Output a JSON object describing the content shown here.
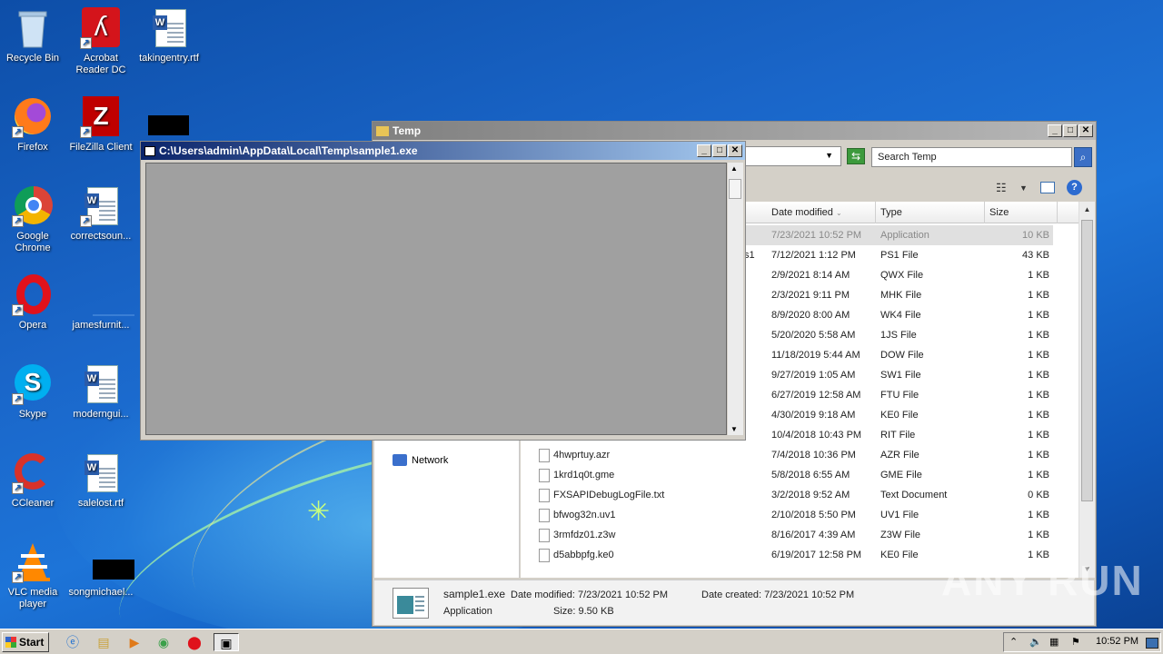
{
  "desktop": {
    "icons": [
      {
        "label": "Recycle Bin"
      },
      {
        "label": "Acrobat Reader DC"
      },
      {
        "label": "takingentry.rtf"
      },
      {
        "label": "Firefox"
      },
      {
        "label": "FileZilla Client"
      },
      {
        "label": "Google Chrome"
      },
      {
        "label": "correctsoun..."
      },
      {
        "label": "Opera"
      },
      {
        "label": "jamesfurnit..."
      },
      {
        "label": "Skype"
      },
      {
        "label": "moderngui..."
      },
      {
        "label": "CCleaner"
      },
      {
        "label": "salelost.rtf"
      },
      {
        "label": "VLC media player"
      },
      {
        "label": "songmichael..."
      }
    ]
  },
  "explorer": {
    "title": "Temp",
    "search_placeholder": "Search Temp",
    "columns": [
      "Date modified",
      "Type",
      "Size"
    ],
    "rows": [
      {
        "name": "",
        "date": "7/23/2021 10:52 PM",
        "type": "Application",
        "size": "10 KB"
      },
      {
        "name": "s1",
        "date": "7/12/2021 1:12 PM",
        "type": "PS1 File",
        "size": "43 KB"
      },
      {
        "name": "",
        "date": "2/9/2021 8:14 AM",
        "type": "QWX File",
        "size": "1 KB"
      },
      {
        "name": "",
        "date": "2/3/2021 9:11 PM",
        "type": "MHK File",
        "size": "1 KB"
      },
      {
        "name": "",
        "date": "8/9/2020 8:00 AM",
        "type": "WK4 File",
        "size": "1 KB"
      },
      {
        "name": "",
        "date": "5/20/2020 5:58 AM",
        "type": "1JS File",
        "size": "1 KB"
      },
      {
        "name": "",
        "date": "11/18/2019 5:44 AM",
        "type": "DOW File",
        "size": "1 KB"
      },
      {
        "name": "",
        "date": "9/27/2019 1:05 AM",
        "type": "SW1 File",
        "size": "1 KB"
      },
      {
        "name": "",
        "date": "6/27/2019 12:58 AM",
        "type": "FTU File",
        "size": "1 KB"
      },
      {
        "name": "",
        "date": "4/30/2019 9:18 AM",
        "type": "KE0 File",
        "size": "1 KB"
      },
      {
        "name": "",
        "date": "10/4/2018 10:43 PM",
        "type": "RIT File",
        "size": "1 KB"
      },
      {
        "name": "4hwprtuy.azr",
        "date": "7/4/2018 10:36 PM",
        "type": "AZR File",
        "size": "1 KB"
      },
      {
        "name": "1krd1q0t.gme",
        "date": "5/8/2018 6:55 AM",
        "type": "GME File",
        "size": "1 KB"
      },
      {
        "name": "FXSAPIDebugLogFile.txt",
        "date": "3/2/2018 9:52 AM",
        "type": "Text Document",
        "size": "0 KB"
      },
      {
        "name": "bfwog32n.uv1",
        "date": "2/10/2018 5:50 PM",
        "type": "UV1 File",
        "size": "1 KB"
      },
      {
        "name": "3rmfdz01.z3w",
        "date": "8/16/2017 4:39 AM",
        "type": "Z3W File",
        "size": "1 KB"
      },
      {
        "name": "d5abbpfg.ke0",
        "date": "6/19/2017 12:58 PM",
        "type": "KE0 File",
        "size": "1 KB"
      }
    ],
    "nav_network": "Network",
    "details": {
      "name": "sample1.exe",
      "type": "Application",
      "date_modified": "Date modified: 7/23/2021 10:52 PM",
      "size": "Size: 9.50 KB",
      "date_created": "Date created: 7/23/2021 10:52 PM"
    }
  },
  "console": {
    "title": "C:\\Users\\admin\\AppData\\Local\\Temp\\sample1.exe"
  },
  "taskbar": {
    "start_label": "Start",
    "clock": "10:52 PM"
  },
  "watermark": "ANY RUN"
}
